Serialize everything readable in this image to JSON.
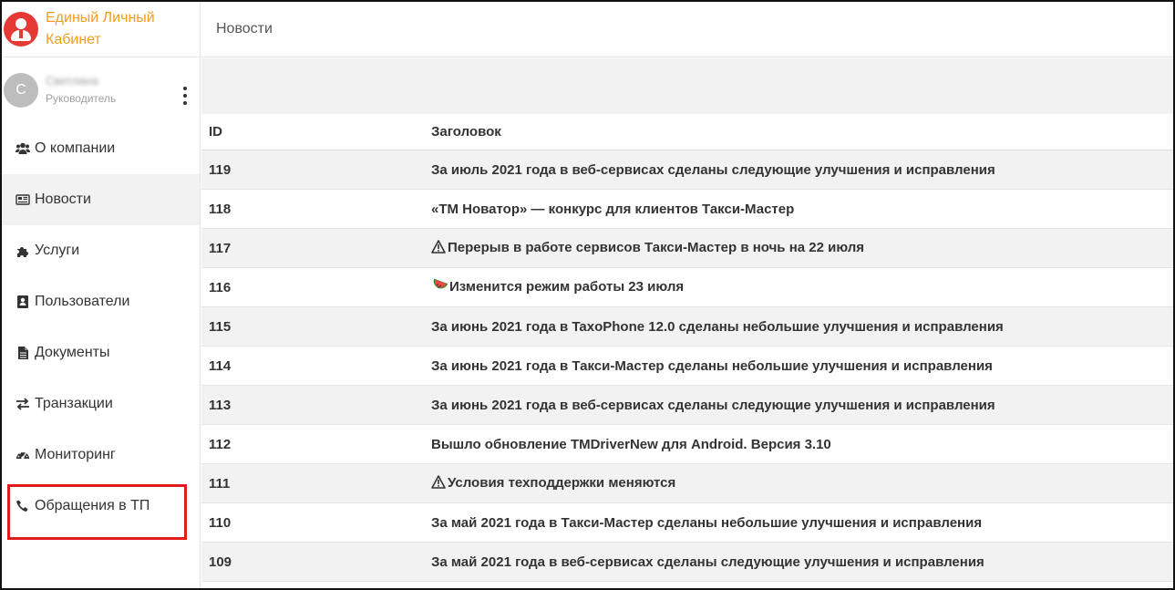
{
  "brand": {
    "title": "Единый Личный Кабинет"
  },
  "user": {
    "initial": "С",
    "name": "Светлана",
    "role": "Руководитель"
  },
  "nav": [
    {
      "label": "О компании",
      "icon": "users-icon"
    },
    {
      "label": "Новости",
      "icon": "newspaper-icon",
      "active": true
    },
    {
      "label": "Услуги",
      "icon": "puzzle-icon"
    },
    {
      "label": "Пользователи",
      "icon": "contact-card-icon"
    },
    {
      "label": "Документы",
      "icon": "document-icon"
    },
    {
      "label": "Транзакции",
      "icon": "exchange-icon"
    },
    {
      "label": "Мониторинг",
      "icon": "dashboard-gauge-icon"
    },
    {
      "label": "Обращения в ТП",
      "icon": "phone-icon",
      "highlighted": true
    }
  ],
  "page": {
    "title": "Новости"
  },
  "table": {
    "headers": {
      "id": "ID",
      "title": "Заголовок"
    },
    "rows": [
      {
        "id": "119",
        "title": "За июль 2021 года в веб-сервисах сделаны следующие улучшения и исправления"
      },
      {
        "id": "118",
        "title": "«ТМ Новатор» — конкурс для клиентов Такси-Мастер"
      },
      {
        "id": "117",
        "title": "Перерыв в работе сервисов Такси-Мастер в ночь на 22 июля",
        "icon": "warning-icon"
      },
      {
        "id": "116",
        "title": "Изменится режим работы 23 июля",
        "icon": "watermelon-icon"
      },
      {
        "id": "115",
        "title": "За июнь 2021 года в TaxoPhone 12.0 сделаны небольшие улучшения и исправления"
      },
      {
        "id": "114",
        "title": "За июнь 2021 года в Такси-Мастер сделаны небольшие улучшения и исправления"
      },
      {
        "id": "113",
        "title": "За июнь 2021 года в веб-сервисах сделаны следующие улучшения и исправления"
      },
      {
        "id": "112",
        "title": "Вышло обновление TMDriverNew для Android. Версия 3.10"
      },
      {
        "id": "111",
        "title": "Условия техподдержки меняются",
        "icon": "warning-icon"
      },
      {
        "id": "110",
        "title": "За май 2021 года в Такси-Мастер сделаны небольшие улучшения и исправления"
      },
      {
        "id": "109",
        "title": "За май 2021 года в веб-сервисах сделаны следующие улучшения и исправления"
      }
    ]
  },
  "colors": {
    "brand": "#f29d1c",
    "logo": "#e53935",
    "highlight": "#e01b1b",
    "stripe": "#f2f2f2"
  }
}
